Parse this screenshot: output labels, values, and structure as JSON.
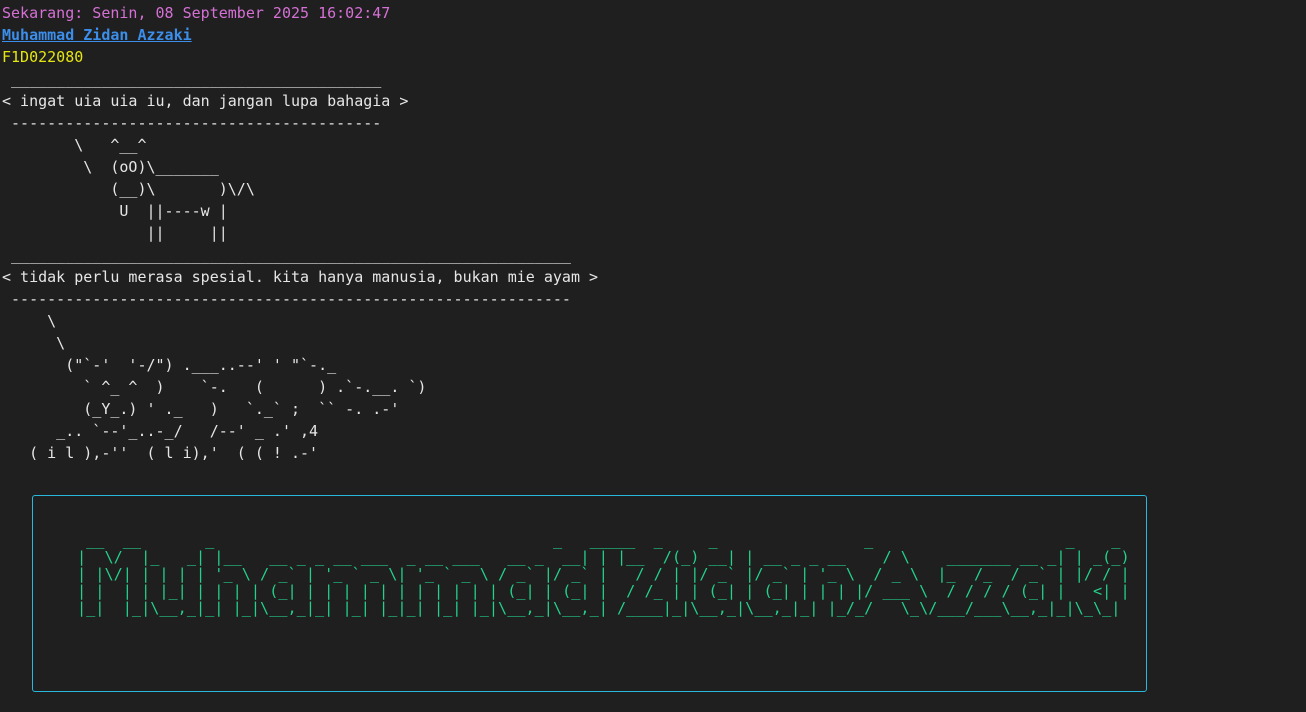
{
  "header": {
    "datetime": "Sekarang: Senin, 08 September 2025 16:02:47",
    "name": "Muhammad Zidan Azzaki",
    "student_id": "F1D022080"
  },
  "cowsay": {
    "message": "ingat uia uia iu, dan jangan lupa bahagia",
    "art": " _________________________________________\n< ingat uia uia iu, dan jangan lupa bahagia >\n -----------------------------------------\n        \\   ^__^\n         \\  (oO)\\_______\n            (__)\\       )\\/\\\n             U  ||----w |\n                ||     ||"
  },
  "rhinosay": {
    "message": "tidak perlu merasa spesial. kita hanya manusia, bukan mie ayam",
    "art": " ______________________________________________________________\n< tidak perlu merasa spesial. kita hanya manusia, bukan mie ayam >\n --------------------------------------------------------------\n     \\\n      \\\n       (\"`-'  '-/\") .___..--' ' \"`-._\n         ` ^_ ^  )    `-.   (      ) .`-.__. `)\n         (_Y_.) ' ._   )   `._` ;  `` -. .-'\n      _.. `--'_..-_/   /--' _ .' ,4\n   ( i l ),-''  ( l i),'  ( ( ! .-'"
  },
  "banner": {
    "text": "Muhammad Zidan Azzaki",
    "art": " __  __       _                                     _   _____  _     _                _                     _    _ \n|  \\/  |_   _| |__   __ _ _ __ ___  _ __ ___   __ _  __| | |__  /(_) __| | __ _ _ __    / \\    _______ __ _| | _(_)\n| |\\/| | | | | '_ \\ / _` | '_ ` _ \\| '_ ` _ \\ / _` |/ _` |   / / | |/ _` |/ _` | '_ \\  / _ \\  |_  /_  / _` | |/ / |\n| |  | | |_| | | | | (_| | | | | | | | | | | | (_| | (_| |  / /_ | | (_| | (_| | | | |/ ___ \\  / / / / (_| |   <| |\n|_|  |_|\\__,_|_| |_|\\__,_|_| |_| |_|_| |_| |_|\\__,_|\\__,_| /____|_|\\__,_|\\__,_|_| |_/_/   \\_\\/___/___\\__,_|_|\\_\\_|"
  },
  "colors": {
    "background": "#1f1f1f",
    "datetime": "#d670d6",
    "name_link": "#3b8eea",
    "student_id": "#e5e510",
    "banner_text": "#23d18b",
    "banner_border": "#29b8db"
  }
}
